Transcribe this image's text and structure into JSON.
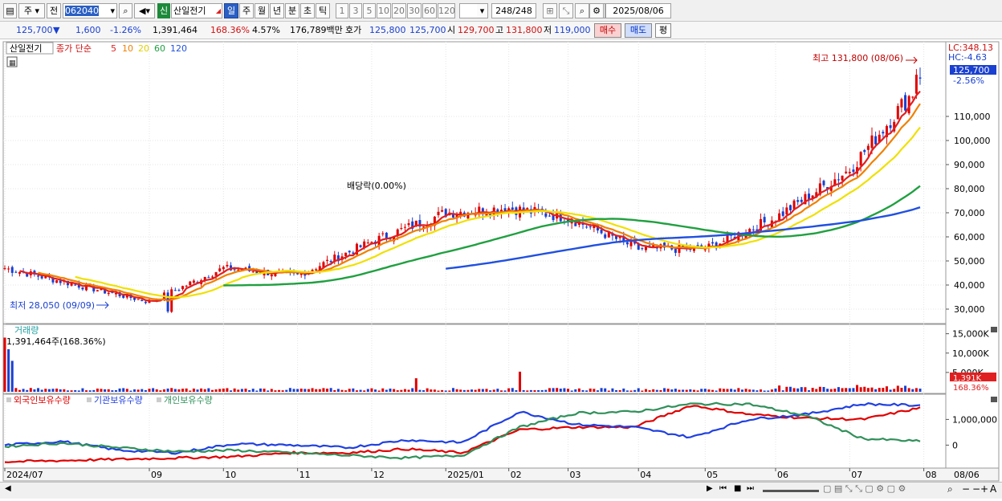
{
  "toolbar": {
    "market_select": "주",
    "prev_label": "전",
    "stock_code": "062040",
    "credit_badge": "신",
    "stock_name": "산일전기",
    "periods": [
      "일",
      "주",
      "월",
      "년",
      "분",
      "초",
      "틱"
    ],
    "selected_period": "일",
    "intervals": [
      "1",
      "3",
      "5",
      "10",
      "20",
      "30",
      "60",
      "120"
    ],
    "count": "248",
    "count_total": "/248",
    "date": "2025/08/06"
  },
  "quote": {
    "price": "125,700",
    "change": "1,600",
    "change_pct": "-1.26%",
    "volume": "1,391,464",
    "volume_ratio": "168.36%",
    "turnover_pct": "4.57%",
    "amount": "176,789백만",
    "ask_label": "호가",
    "ask": "125,800",
    "bid": "125,700",
    "open_label": "시",
    "open": "129,700",
    "high_label": "고",
    "high": "131,800",
    "low_label": "저",
    "low": "119,000",
    "buy_label": "매수",
    "sell_label": "매도",
    "eval_label": "평"
  },
  "price_panel": {
    "stock_label": "산일전기",
    "ma_title": "종가 단순",
    "ma_periods": [
      "5",
      "10",
      "20",
      "60",
      "120"
    ],
    "ma_colors": [
      "#e02020",
      "#f08000",
      "#f0e000",
      "#20a040",
      "#2050e0"
    ],
    "high_note": "최고 131,800 (08/06)",
    "low_note": "최저 28,050 (09/09)",
    "dividend_note": "배당락(0.00%)",
    "lc": "LC:348.13",
    "hc": "HC:-4.63",
    "current_tag": "125,700",
    "current_pct": "-2.56%",
    "y_ticks": [
      "110,000",
      "100,000",
      "90,000",
      "80,000",
      "70,000",
      "60,000",
      "50,000",
      "40,000",
      "30,000"
    ]
  },
  "volume_panel": {
    "title": "거래량",
    "value_text": "1,391,464주(168.36%)",
    "y_ticks": [
      "15,000K",
      "10,000K",
      "5,000K"
    ],
    "current_tag": "1,391K",
    "current_pct": "168.36%"
  },
  "holding_panel": {
    "series": [
      "외국인보유수량",
      "기관보유수량",
      "개인보유수량"
    ],
    "colors": [
      "#e00000",
      "#2040e0",
      "#30905a"
    ],
    "y_ticks": [
      "1,000,000",
      "0"
    ]
  },
  "x_axis": {
    "labels": [
      "2024/07",
      "09",
      "10",
      "11",
      "12",
      "2025/01",
      "02",
      "03",
      "04",
      "05",
      "06",
      "07",
      "08"
    ],
    "right_label": "08/06"
  },
  "chart_data": {
    "type": "candlestick",
    "period": "daily",
    "max_price": 131800,
    "max_date": "08/06",
    "min_price": 28050,
    "min_date": "09/09",
    "close_current": 125700,
    "ylim": [
      25000,
      135000
    ],
    "monthly_closes_approx": [
      {
        "month": "2024/07",
        "close": 47000
      },
      {
        "month": "09",
        "close": 33000
      },
      {
        "month": "10",
        "close": 47000
      },
      {
        "month": "11",
        "close": 44000
      },
      {
        "month": "12",
        "close": 58000
      },
      {
        "month": "2025/01",
        "close": 70000
      },
      {
        "month": "02",
        "close": 72000
      },
      {
        "month": "03",
        "close": 68000
      },
      {
        "month": "04",
        "close": 55000
      },
      {
        "month": "05",
        "close": 55000
      },
      {
        "month": "06",
        "close": 68000
      },
      {
        "month": "07",
        "close": 88000
      },
      {
        "month": "08",
        "close": 125700
      }
    ]
  }
}
